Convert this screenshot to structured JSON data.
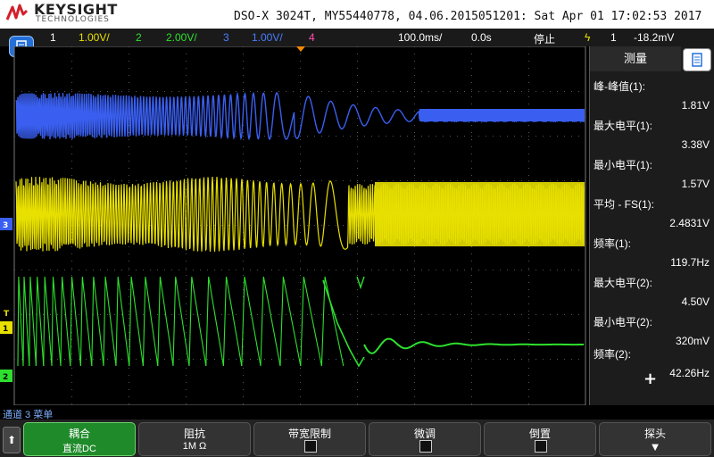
{
  "header": {
    "brand": "KEYSIGHT",
    "brand_sub": "TECHNOLOGIES",
    "title": "DSO-X 3024T, MY55440778, 04.06.2015051201: Sat Apr 01 17:02:53 2017"
  },
  "channel_bar": {
    "ch1_num": "1",
    "ch1_scale": "1.00V/",
    "ch2_num": "2",
    "ch2_scale": "2.00V/",
    "ch3_num": "3",
    "ch3_scale": "1.00V/",
    "ch4_num": "4",
    "timebase": "100.0ms/",
    "delay": "0.0s",
    "run_state": "停止",
    "trig_icon": "trigger-edge-icon",
    "trig_src": "1",
    "trig_level": "-18.2mV"
  },
  "colors": {
    "ch1": "#e8e000",
    "ch2": "#2ee02e",
    "ch3": "#3a5ff0",
    "ch4": "#ff4fb0",
    "accent": "#2470d8"
  },
  "markers": {
    "ch3": "3",
    "ch1": "1",
    "ch2": "2",
    "trigger": "T"
  },
  "panel": {
    "title": "测量",
    "measurements": [
      {
        "label": "峰-峰值(1):",
        "value": "1.81V"
      },
      {
        "label": "最大电平(1):",
        "value": "3.38V"
      },
      {
        "label": "最小电平(1):",
        "value": "1.57V"
      },
      {
        "label": "平均 - FS(1):",
        "value": "2.4831V"
      },
      {
        "label": "频率(1):",
        "value": "119.7Hz"
      },
      {
        "label": "最大电平(2):",
        "value": "4.50V"
      },
      {
        "label": "最小电平(2):",
        "value": "320mV"
      },
      {
        "label": "频率(2):",
        "value": "42.26Hz"
      }
    ],
    "add_icon": "plus-icon"
  },
  "softkeys": {
    "menu_label": "通道 3 菜单",
    "keys": [
      {
        "top": "耦合",
        "bottom": "直流DC"
      },
      {
        "top": "阻抗",
        "bottom": "1M Ω"
      },
      {
        "top": "带宽限制",
        "bottom": ""
      },
      {
        "top": "微调",
        "bottom": ""
      },
      {
        "top": "倒置",
        "bottom": ""
      },
      {
        "top": "探头",
        "bottom": ""
      }
    ]
  }
}
